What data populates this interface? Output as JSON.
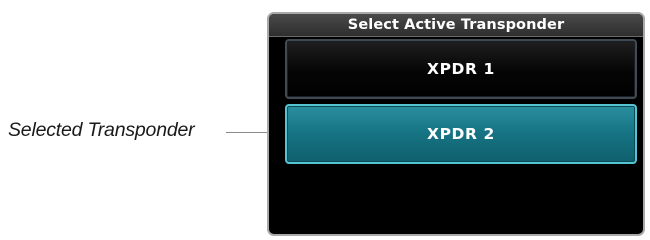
{
  "callout": {
    "label": "Selected Transponder"
  },
  "window": {
    "title": "Select Active Transponder",
    "buttons": [
      {
        "label": "XPDR 1",
        "selected": false
      },
      {
        "label": "XPDR 2",
        "selected": true
      }
    ]
  },
  "colors": {
    "selected_fill": "#177585",
    "selected_border": "#55c4d2",
    "unselected_fill": "#000000",
    "window_border": "#a9a9a9"
  }
}
